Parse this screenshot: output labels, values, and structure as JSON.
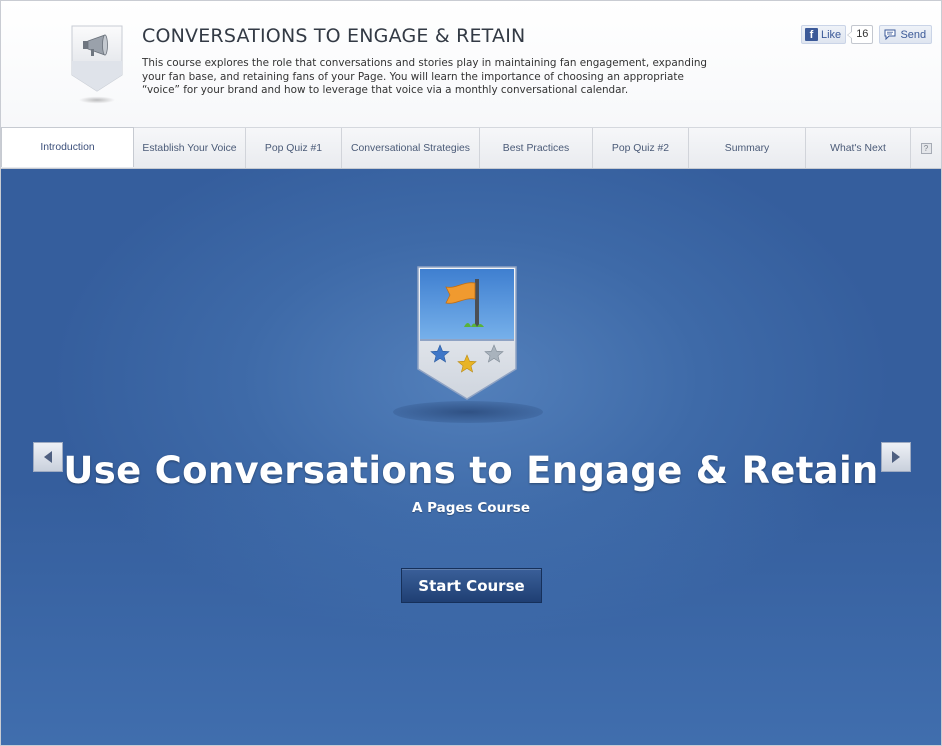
{
  "header": {
    "title": "CONVERSATIONS TO ENGAGE & RETAIN",
    "description": "This course explores the role that conversations and stories play in maintaining fan engagement, expanding your fan base, and retaining fans of your Page. You will learn the importance of choosing an appropriate “voice” for your brand and how to leverage that voice via a monthly conversational calendar.",
    "icon": "megaphone-icon"
  },
  "social": {
    "like_label": "Like",
    "like_count": "16",
    "send_label": "Send",
    "brand_color": "#3b5998"
  },
  "tabs": [
    {
      "label": "Introduction",
      "active": true
    },
    {
      "label": "Establish Your Voice",
      "active": false
    },
    {
      "label": "Pop Quiz #1",
      "active": false
    },
    {
      "label": "Conversational Strategies",
      "active": false
    },
    {
      "label": "Best Practices",
      "active": false
    },
    {
      "label": "Pop Quiz #2",
      "active": false
    },
    {
      "label": "Summary",
      "active": false
    },
    {
      "label": "What's Next",
      "active": false
    }
  ],
  "help": {
    "glyph": "?"
  },
  "stage": {
    "badge_icon": "flag-badge-icon",
    "title": "Use Conversations to Engage & Retain",
    "subtitle": "A Pages Course",
    "start_label": "Start Course",
    "background_color": "#3e6aa8"
  }
}
